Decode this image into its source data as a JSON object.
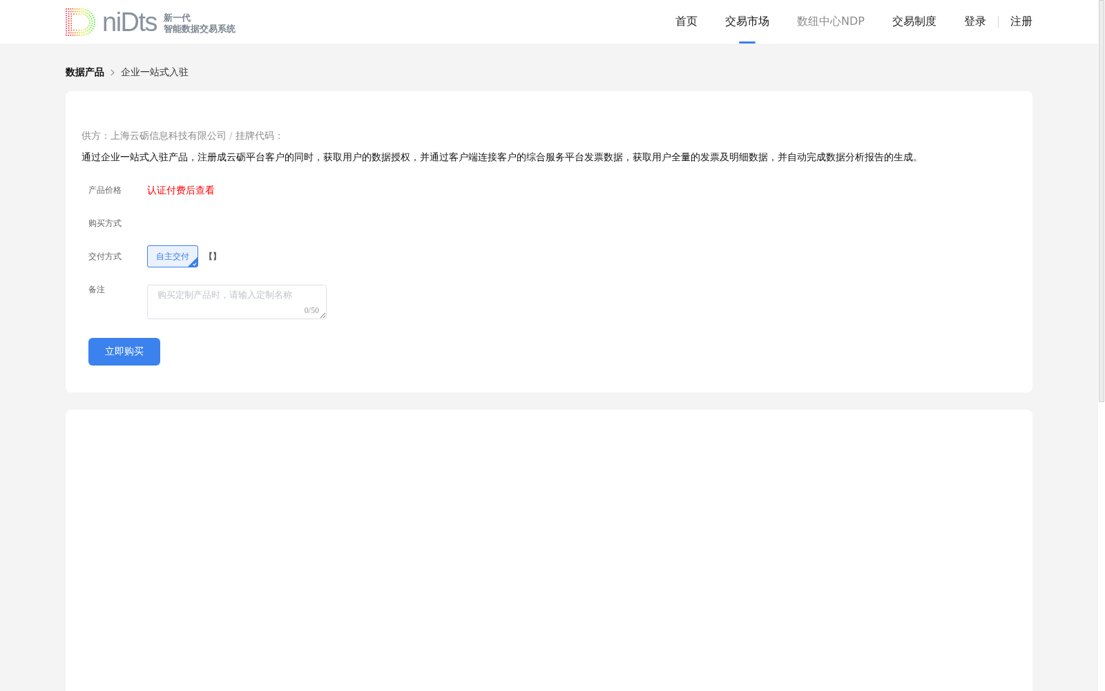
{
  "header": {
    "logo": {
      "wordmark": "niDts",
      "tagline": [
        "新一代",
        "智能数据交易系统"
      ]
    },
    "nav": [
      {
        "label": "首页",
        "selected": false,
        "disabled": false
      },
      {
        "label": "交易市场",
        "selected": true,
        "disabled": false
      },
      {
        "label": "数纽中心NDP",
        "selected": false,
        "disabled": true
      },
      {
        "label": "交易制度",
        "selected": false,
        "disabled": false
      }
    ],
    "auth_links": [
      "登录",
      "注册"
    ]
  },
  "breadcrumb": [
    "数据产品",
    "企业一站式入驻"
  ],
  "product": {
    "supplier": "供方：上海云砺信息科技有限公司",
    "separator": "/",
    "listing_code_label": "挂牌代码：",
    "description": "通过企业一站式入驻产品，注册成云砺平台客户的同时，获取用户的数据授权，并通过客户端连接客户的综合服务平台发票数据，获取用户全量的发票及明细数据，并自动完成数据分析报告的生成。",
    "fields": [
      {
        "kind": "price",
        "label": "产品价格",
        "value": "认证付费后查看"
      },
      {
        "kind": "empty",
        "label": "购买方式"
      },
      {
        "kind": "options",
        "label": "交付方式",
        "options": [
          {
            "label": "自主交付",
            "selected": true
          }
        ],
        "suffix": "【】"
      },
      {
        "kind": "textarea",
        "label": "备注",
        "placeholder": "购买定制产品时，请输入定制名称",
        "counter": "0/50"
      }
    ],
    "buy_button": "立即购买"
  }
}
